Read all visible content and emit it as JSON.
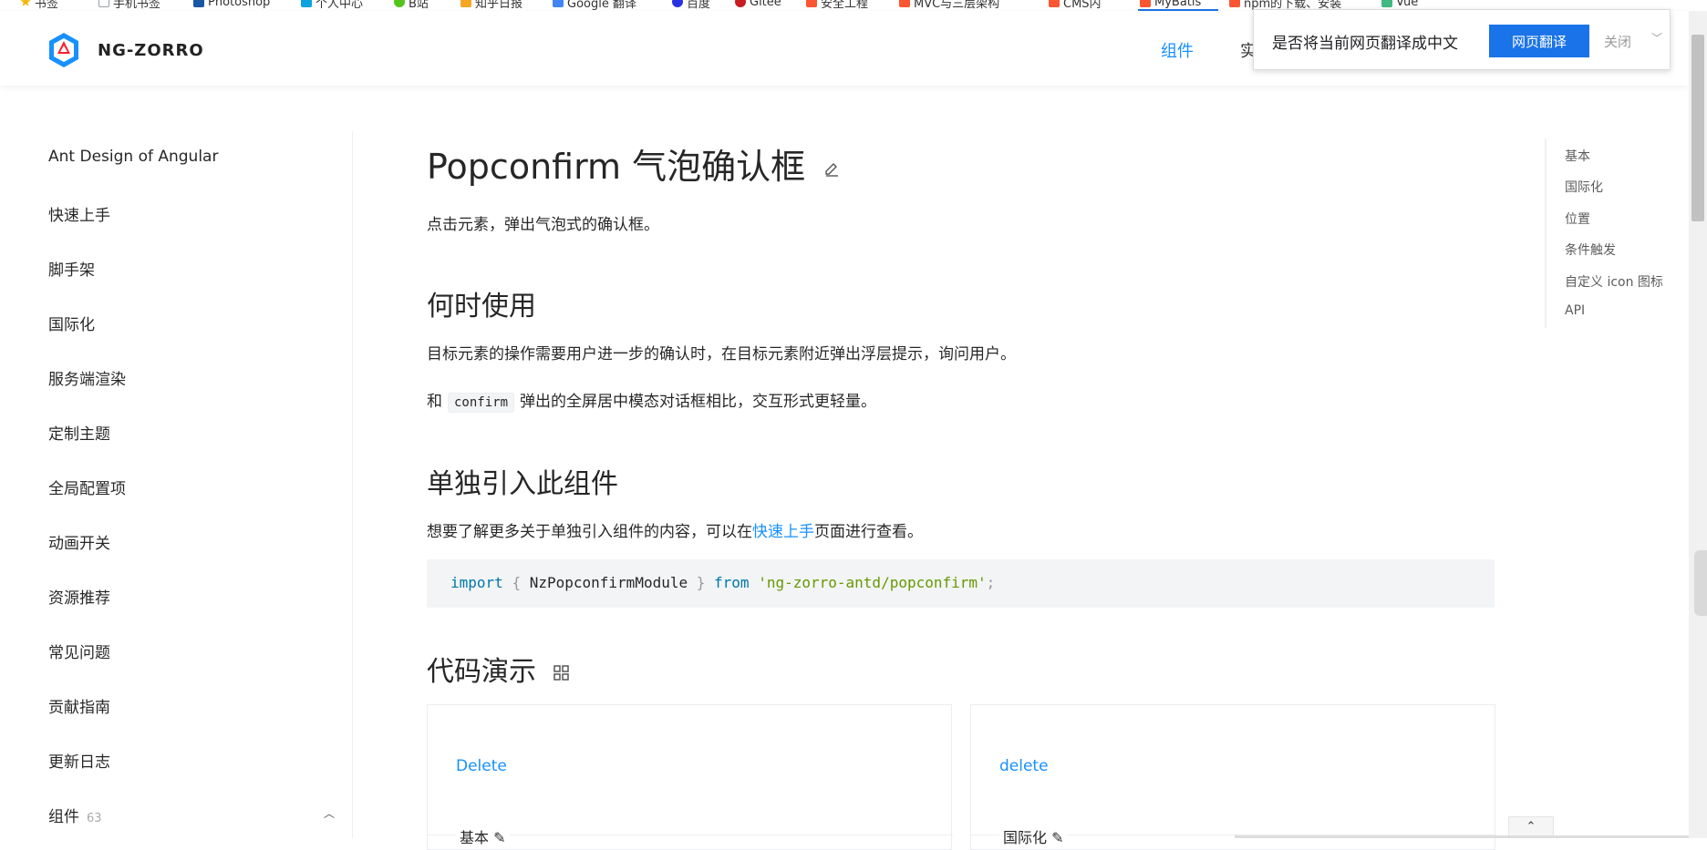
{
  "bookmarks": [
    {
      "label": "书签",
      "color": "#f4b400"
    },
    {
      "label": "手机书签",
      "color": "#9aa0a6"
    },
    {
      "label": "Photoshop",
      "color": "#1a56a6"
    },
    {
      "label": "个人中心",
      "color": "#0ca3e0"
    },
    {
      "label": "B站",
      "color": "#52c41a"
    },
    {
      "label": "知乎日报",
      "color": "#f5a623"
    },
    {
      "label": "Google 翻译",
      "color": "#4285f4"
    },
    {
      "label": "百度",
      "color": "#2932e1"
    },
    {
      "label": "Gitee",
      "color": "#c71d23"
    },
    {
      "label": "安全工程",
      "color": "#fc5531"
    },
    {
      "label": "MVC与三层架构",
      "color": "#fc5531"
    },
    {
      "label": "CMS内",
      "color": "#fc5531"
    },
    {
      "label": "MyBatis",
      "color": "#fc5531"
    },
    {
      "label": "npm的下载、安装",
      "color": "#fc5531"
    },
    {
      "label": "Vue",
      "color": "#42b883"
    }
  ],
  "header": {
    "brand": "NG-ZORRO",
    "nav_active": "组件",
    "nav_second": "实"
  },
  "translate_popup": {
    "prompt": "是否将当前网页翻译成中文",
    "translate_button": "网页翻译",
    "close_label": "关闭"
  },
  "sidebar": {
    "items": [
      {
        "label": "Ant Design of Angular"
      },
      {
        "label": "快速上手"
      },
      {
        "label": "脚手架"
      },
      {
        "label": "国际化"
      },
      {
        "label": "服务端渲染"
      },
      {
        "label": "定制主题"
      },
      {
        "label": "全局配置项"
      },
      {
        "label": "动画开关"
      },
      {
        "label": "资源推荐"
      },
      {
        "label": "常见问题"
      },
      {
        "label": "贡献指南"
      },
      {
        "label": "更新日志"
      },
      {
        "label": "组件",
        "count": "63"
      }
    ]
  },
  "main": {
    "title": "Popconfirm 气泡确认框",
    "subtitle": "点击元素，弹出气泡式的确认框。",
    "when_heading": "何时使用",
    "when_p1": "目标元素的操作需要用户进一步的确认时，在目标元素附近弹出浮层提示，询问用户。",
    "when_p2_before": "和",
    "when_p2_code": "confirm",
    "when_p2_after": "弹出的全屏居中模态对话框相比，交互形式更轻量。",
    "import_heading": "单独引入此组件",
    "import_p_before": "想要了解更多关于单独引入组件的内容，可以在",
    "import_p_link": "快速上手",
    "import_p_after": "页面进行查看。",
    "code": {
      "kw_import": "import",
      "brace_open": "{",
      "module": "NzPopconfirmModule",
      "brace_close": "}",
      "kw_from": "from",
      "path": "'ng-zorro-antd/popconfirm'",
      "semi": ";"
    },
    "demo_heading": "代码演示",
    "cards": [
      {
        "link": "Delete",
        "title": "基本"
      },
      {
        "link": "delete",
        "title": "国际化"
      }
    ]
  },
  "anchor": {
    "items": [
      "基本",
      "国际化",
      "位置",
      "条件触发",
      "自定义 icon 图标",
      "API"
    ]
  },
  "backtop": {
    "label": "⌃"
  }
}
